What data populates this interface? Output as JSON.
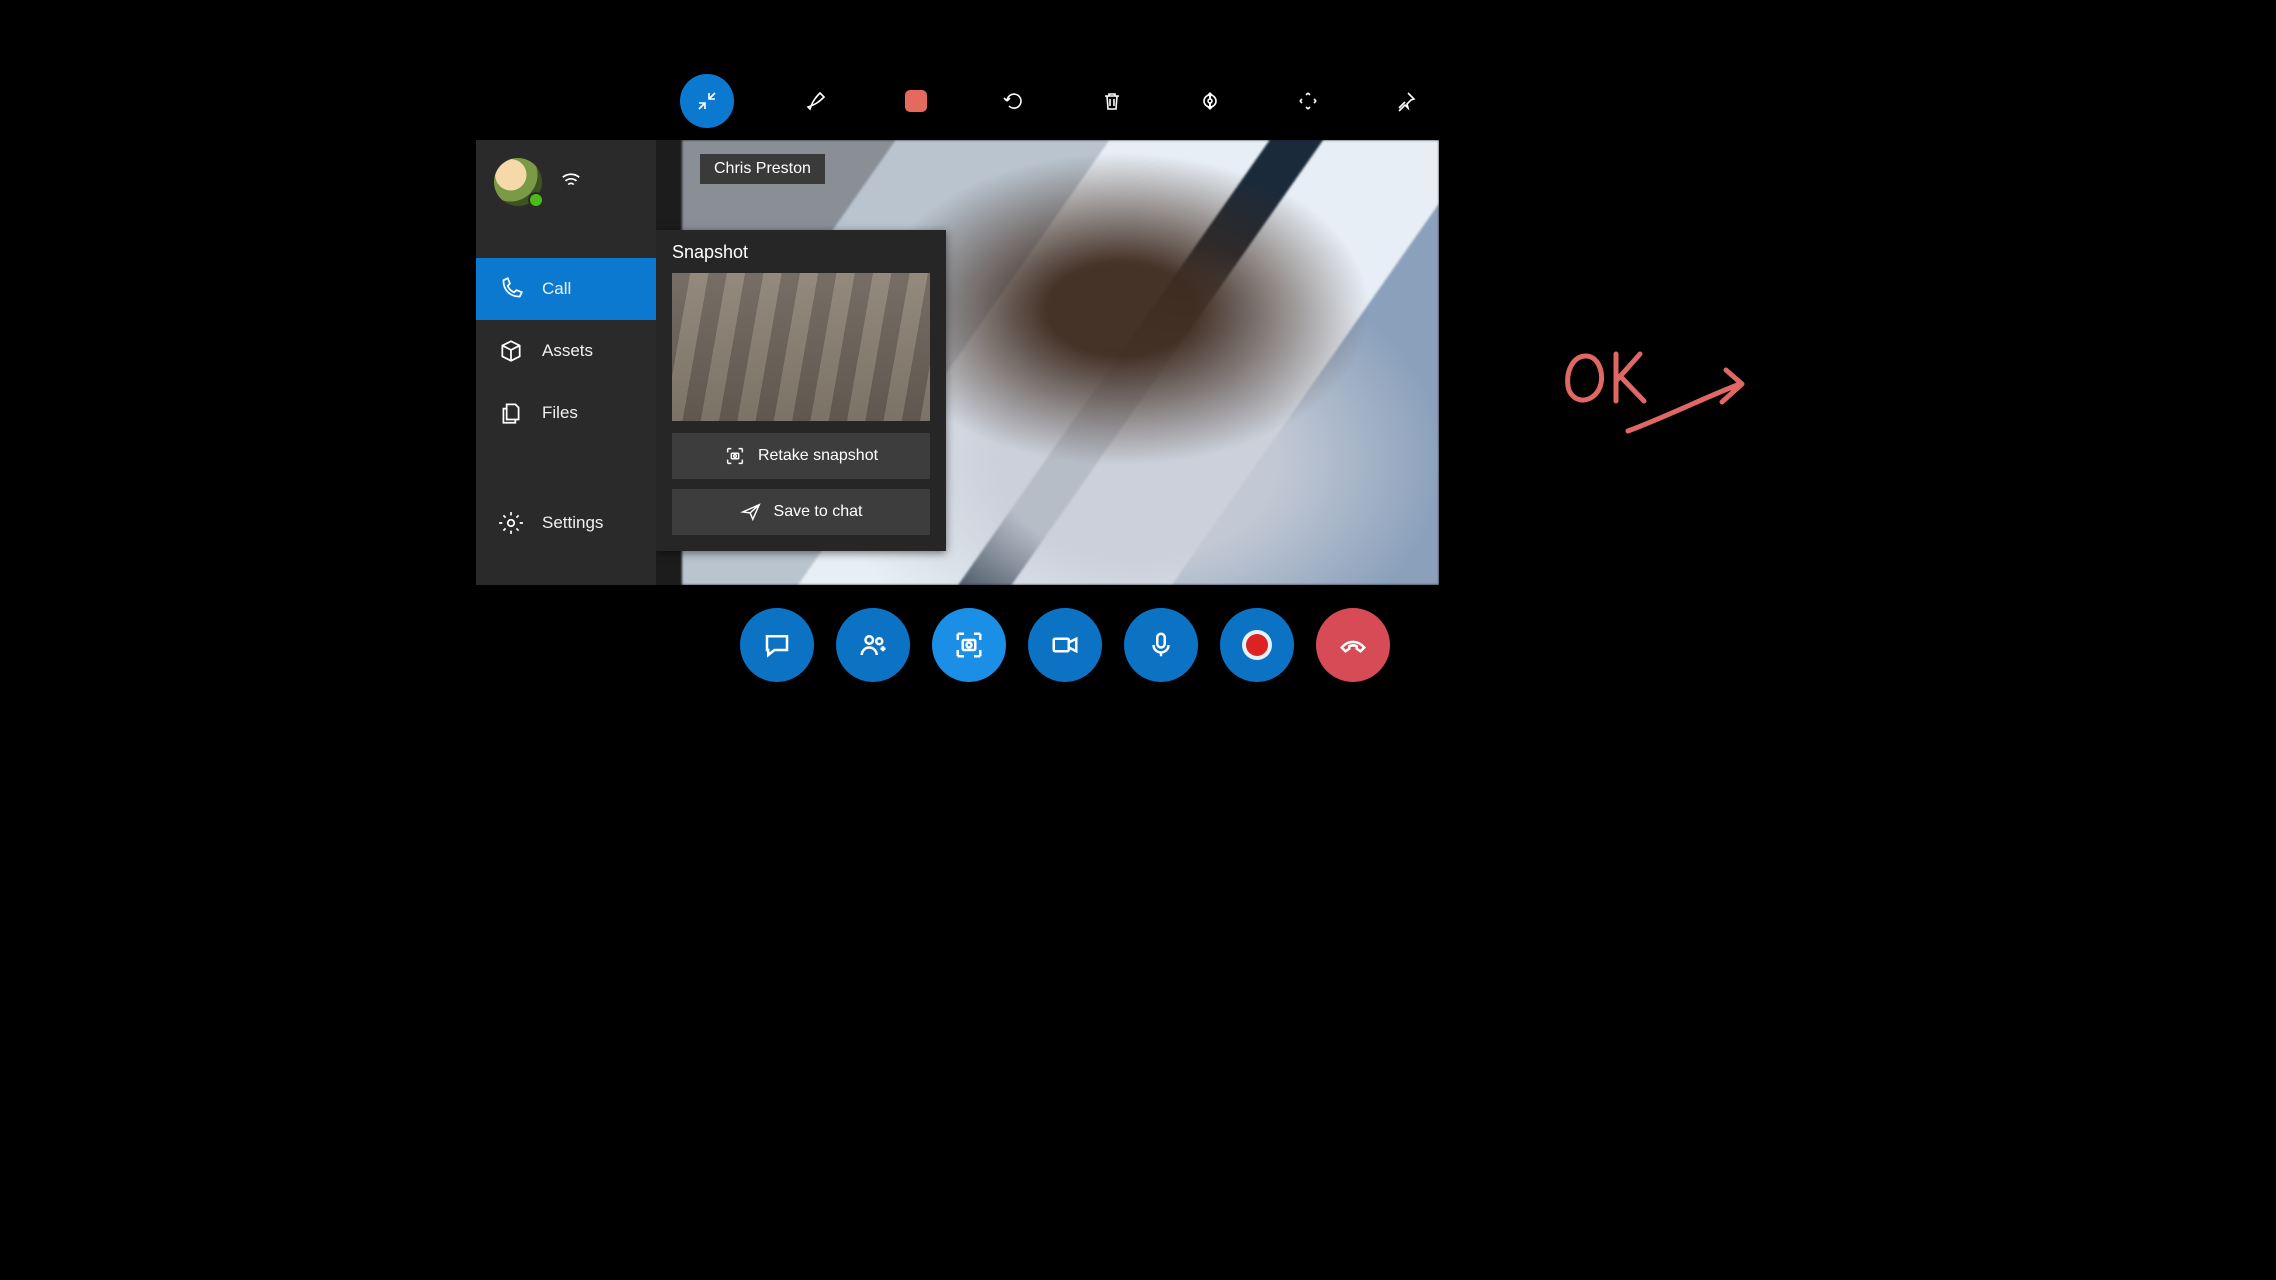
{
  "participant": {
    "name": "Chris Preston"
  },
  "sidebar": {
    "items": [
      {
        "label": "Call"
      },
      {
        "label": "Assets"
      },
      {
        "label": "Files"
      },
      {
        "label": "Settings"
      }
    ]
  },
  "snapshot": {
    "title": "Snapshot",
    "retake_label": "Retake snapshot",
    "save_label": "Save to chat"
  },
  "annotation": {
    "text": "OK"
  }
}
